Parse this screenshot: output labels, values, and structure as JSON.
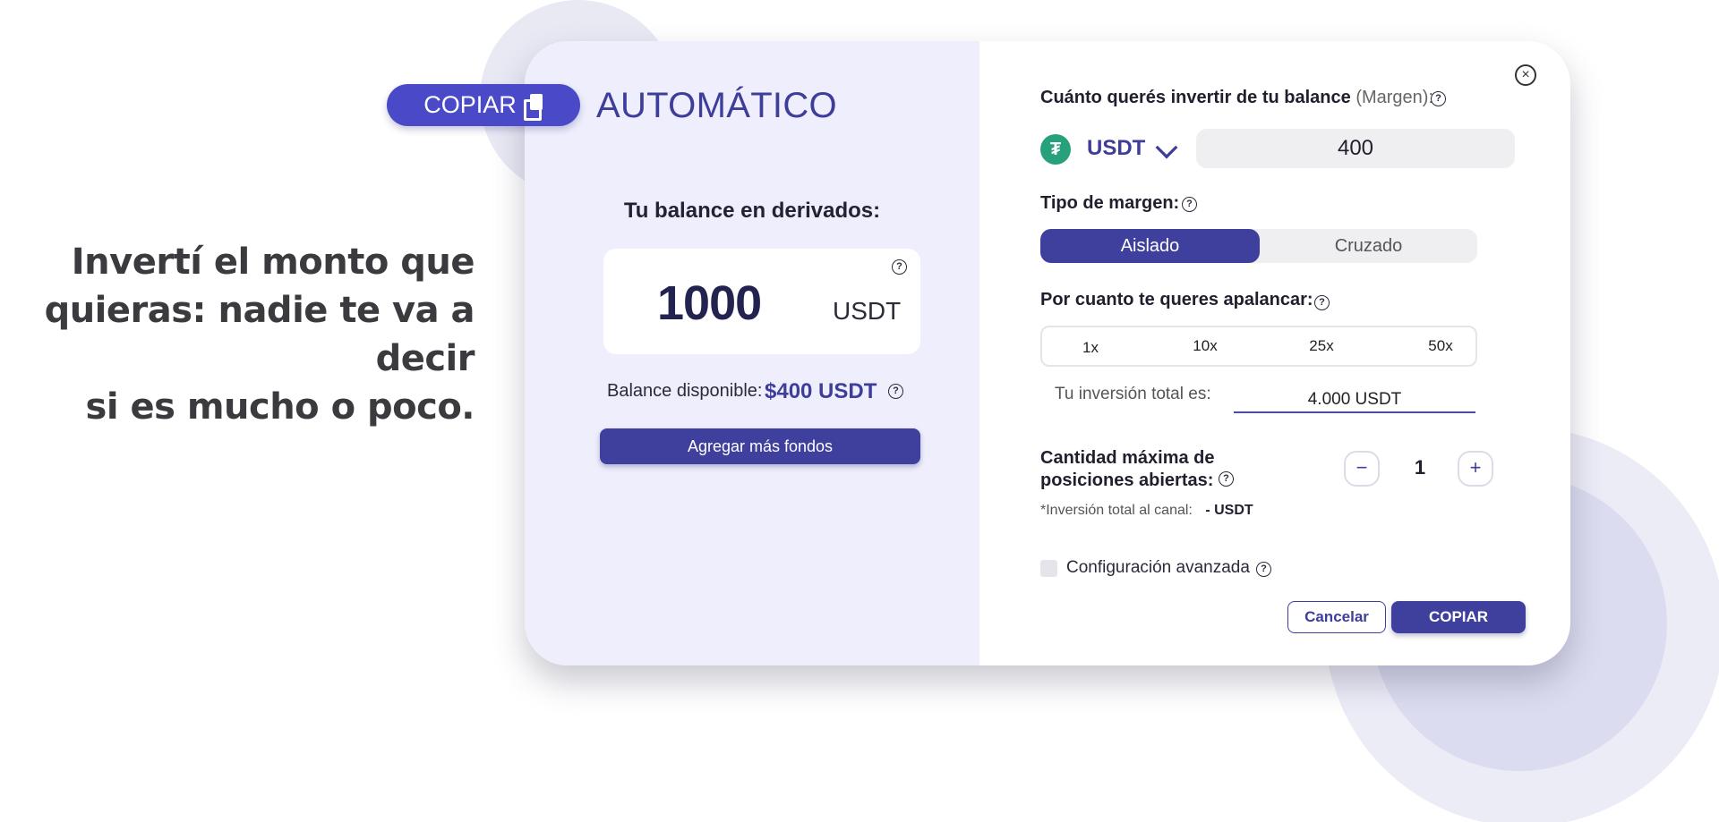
{
  "headline": [
    "Invertí el monto que",
    "quieras: nadie te va a decir",
    "si es mucho o poco."
  ],
  "badge": {
    "copy_label": "COPIAR",
    "icon": "copy-icon",
    "title": "AUTOMÁTICO"
  },
  "left_panel": {
    "balance_title": "Tu balance en derivados:",
    "balance_amount": "1000",
    "balance_unit": "USDT",
    "available_label": "Balance disponible:",
    "available_value": "$400 USDT",
    "add_funds_button": "Agregar más fondos"
  },
  "right_panel": {
    "invest_label": "Cuánto querés invertir de tu balance",
    "invest_label_muted": "(Margen):",
    "currency": "USDT",
    "amount": "400",
    "margin_type_label": "Tipo de margen:",
    "margin_options": [
      "Aislado",
      "Cruzado"
    ],
    "margin_selected": "Aislado",
    "leverage_label": "Por cuanto te queres apalancar:",
    "leverage_options": [
      "1x",
      "10x",
      "25x",
      "50x"
    ],
    "leverage_selected": "1x",
    "total_label": "Tu inversión total es:",
    "total_value": "4.000 USDT",
    "max_positions_label": "Cantidad máxima de posiciones abiertas:",
    "max_positions_value": "1",
    "channel_total_label": "*Inversión total al canal:",
    "channel_total_value": "- USDT",
    "advanced_label": "Configuración avanzada",
    "cancel_button": "Cancelar",
    "copy_button": "COPIAR"
  },
  "icons": {
    "close": "×",
    "help": "?",
    "minus": "−",
    "plus": "+",
    "coin": "₮"
  },
  "colors": {
    "accent": "#3f3f9e",
    "pill": "#4a4ac8",
    "panel_bg": "#eeeefd",
    "tether": "#26a17b"
  }
}
